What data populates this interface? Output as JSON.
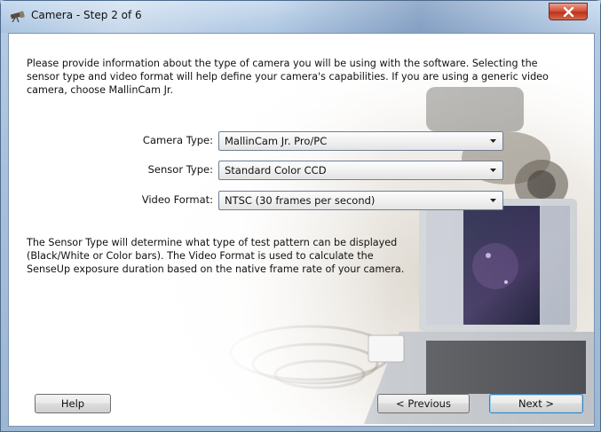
{
  "window": {
    "title": "Camera - Step 2 of 6"
  },
  "intro_text": "Please provide information about the type of camera you will be using with the software. Selecting the sensor type and video format will help define your camera's capabilities. If you are using a generic video camera, choose MallinCam Jr.",
  "form": {
    "camera_type": {
      "label": "Camera Type:",
      "value": "MallinCam Jr. Pro/PC"
    },
    "sensor_type": {
      "label": "Sensor Type:",
      "value": "Standard Color CCD"
    },
    "video_format": {
      "label": "Video Format:",
      "value": "NTSC (30 frames per second)"
    }
  },
  "description_text": "The Sensor Type will determine what type of test pattern can be displayed (Black/White or Color bars). The Video Format is used to calculate the SenseUp exposure duration based on the native frame rate of your camera.",
  "buttons": {
    "help": "Help",
    "previous": "< Previous",
    "next": "Next >"
  }
}
